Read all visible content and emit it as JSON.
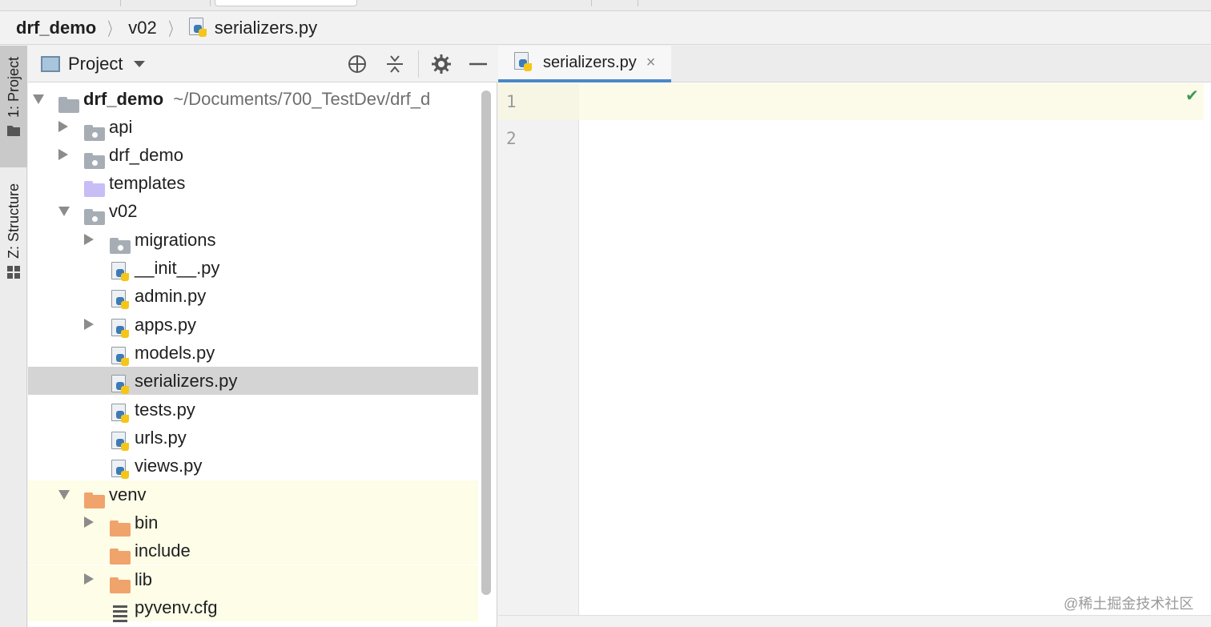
{
  "breadcrumb": {
    "root": "drf_demo",
    "folder": "v02",
    "file": "serializers.py"
  },
  "tool_stripe": {
    "project": "1: Project",
    "structure": "Z: Structure"
  },
  "project_panel": {
    "title": "Project",
    "header_icons": [
      "locate-icon",
      "collapse-all-icon",
      "gear-icon",
      "hide-icon"
    ]
  },
  "tree": {
    "root_label": "drf_demo",
    "root_path": "~/Documents/700_TestDev/drf_d",
    "items": [
      {
        "label": "api"
      },
      {
        "label": "drf_demo"
      },
      {
        "label": "templates"
      },
      {
        "label": "v02"
      },
      {
        "label": "migrations"
      },
      {
        "label": "__init__.py"
      },
      {
        "label": "admin.py"
      },
      {
        "label": "apps.py"
      },
      {
        "label": "models.py"
      },
      {
        "label": "serializers.py"
      },
      {
        "label": "tests.py"
      },
      {
        "label": "urls.py"
      },
      {
        "label": "views.py"
      },
      {
        "label": "venv"
      },
      {
        "label": "bin"
      },
      {
        "label": "include"
      },
      {
        "label": "lib"
      },
      {
        "label": "pyvenv.cfg"
      }
    ]
  },
  "editor": {
    "tab_label": "serializers.py",
    "tab_close": "×",
    "line_numbers": [
      "1",
      "2"
    ],
    "status_check": "✔"
  },
  "watermark": "@稀土掘金技术社区",
  "colors": {
    "tab_underline": "#4a88c7",
    "selection": "#d4d4d4",
    "excluded_bg": "#fdfde8",
    "check_green": "#3d9a52"
  }
}
